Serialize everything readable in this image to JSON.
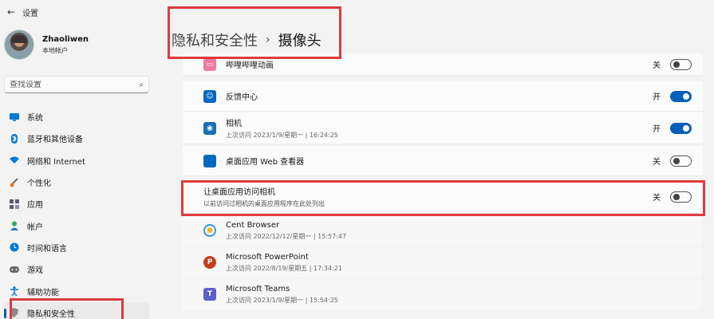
{
  "window": {
    "title": "设置"
  },
  "user": {
    "name": "Zhaoliwen",
    "account": "本地帐户"
  },
  "search": {
    "placeholder": "查找设置"
  },
  "sidebar": {
    "items": [
      {
        "label": "系统",
        "icon": "monitor-icon",
        "color": "#0078d4"
      },
      {
        "label": "蓝牙和其他设备",
        "icon": "bluetooth-icon",
        "color": "#0078d4"
      },
      {
        "label": "网络和 Internet",
        "icon": "wifi-icon",
        "color": "#0078d4"
      },
      {
        "label": "个性化",
        "icon": "brush-icon",
        "color": "#e07a2a"
      },
      {
        "label": "应用",
        "icon": "apps-icon",
        "color": "#5a5a7a"
      },
      {
        "label": "帐户",
        "icon": "person-icon",
        "color": "#2aa860"
      },
      {
        "label": "时间和语言",
        "icon": "clock-globe-icon",
        "color": "#0078d4"
      },
      {
        "label": "游戏",
        "icon": "gamepad-icon",
        "color": "#666666"
      },
      {
        "label": "辅助功能",
        "icon": "accessibility-icon",
        "color": "#0078d4"
      },
      {
        "label": "隐私和安全性",
        "icon": "shield-icon",
        "color": "#777777",
        "active": true
      }
    ]
  },
  "header": {
    "crumb_parent": "隐私和安全性",
    "separator": "›",
    "crumb_current": "摄像头"
  },
  "apps": [
    {
      "name": "哔哩哔哩动画",
      "sub": "",
      "state": "关",
      "on": false,
      "icon": "bilibili-icon",
      "color": "#f07aa0"
    },
    {
      "name": "反馈中心",
      "sub": "",
      "state": "开",
      "on": true,
      "icon": "feedback-hub-icon",
      "color": "#0067c0"
    },
    {
      "name": "相机",
      "sub": "上次访问 2023/1/9/星期一 | 16:24:25",
      "state": "开",
      "on": true,
      "icon": "camera-icon",
      "color": "#1b6fb5"
    },
    {
      "name": "桌面应用 Web 查看器",
      "sub": "",
      "state": "关",
      "on": false,
      "icon": "webview-icon",
      "color": "#0067c0"
    }
  ],
  "desktop_section": {
    "title": "让桌面应用访问相机",
    "sub": "以前访问过相机的桌面应用程序在此处列出",
    "state": "关",
    "on": false
  },
  "desktop_apps": [
    {
      "name": "Cent Browser",
      "sub": "上次访问 2022/12/12/星期一 | 15:57:47",
      "icon": "cent-browser-icon",
      "color": "#2e9be6"
    },
    {
      "name": "Microsoft PowerPoint",
      "sub": "上次访问 2022/8/19/星期五 | 17:34:21",
      "icon": "powerpoint-icon",
      "color": "#c43e1c"
    },
    {
      "name": "Microsoft Teams",
      "sub": "上次访问 2023/1/9/星期一 | 15:54:25",
      "icon": "teams-icon",
      "color": "#5b5fc7"
    }
  ]
}
